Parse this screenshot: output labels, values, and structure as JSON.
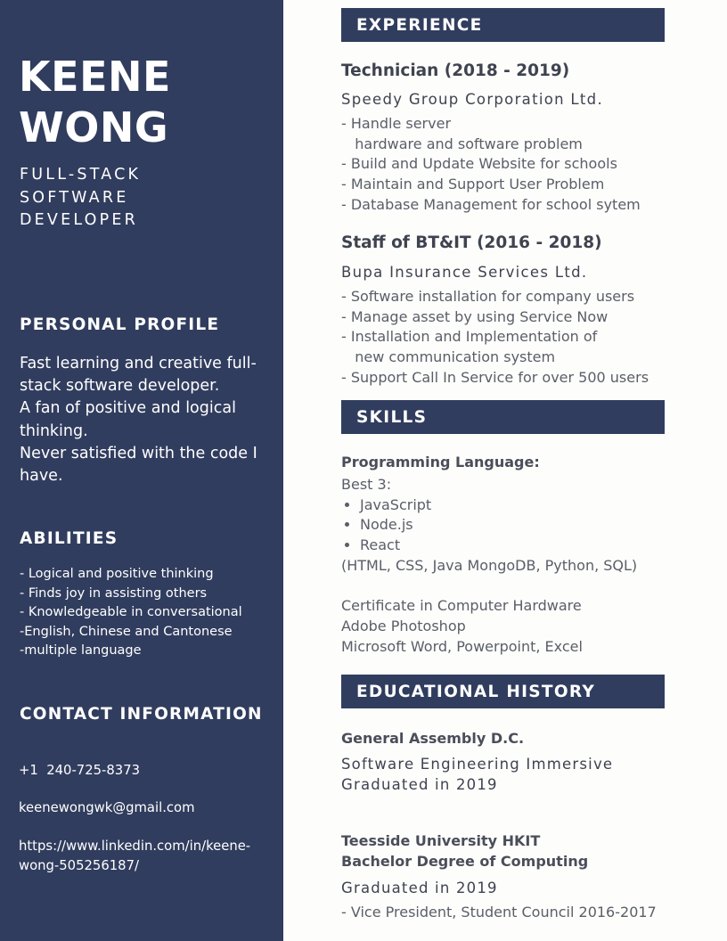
{
  "sidebar": {
    "name_line1": "KEENE",
    "name_line2": "WONG",
    "title_line1": "FULL-STACK",
    "title_line2": "SOFTWARE",
    "title_line3": "DEVELOPER",
    "profile_heading": "PERSONAL PROFILE",
    "profile_lines": [
      "Fast learning and creative full-",
      "stack software developer.",
      "A fan of positive and logical",
      "thinking.",
      "Never satisfied with the code I",
      "have."
    ],
    "abilities_heading": "ABILITIES",
    "abilities": [
      "- Logical and positive thinking",
      "- Finds joy in assisting others",
      "- Knowledgeable in conversational",
      "-English, Chinese and Cantonese",
      "-multiple language"
    ],
    "contact_heading": "CONTACT INFORMATION",
    "phone": "+1  240-725-8373",
    "email": "keenewongwk@gmail.com",
    "linkedin_line1": "https://www.linkedin.com/in/keene-",
    "linkedin_line2": "wong-505256187/"
  },
  "experience": {
    "heading": "EXPERIENCE",
    "jobs": [
      {
        "title": "Technician (2018 - 2019)",
        "company": "Speedy Group Corporation Ltd.",
        "bullets": [
          "- Handle server",
          "   hardware and software problem",
          "- Build and Update Website for schools",
          "- Maintain and Support User Problem",
          "- Database Management for school sytem"
        ]
      },
      {
        "title": "Staff of BT&IT (2016 - 2018)",
        "company": "Bupa Insurance Services Ltd.",
        "bullets": [
          "- Software installation for company users",
          "- Manage asset by using Service Now",
          "- Installation and Implementation of",
          "   new communication system",
          "- Support Call In Service for over 500 users"
        ]
      }
    ]
  },
  "skills": {
    "heading": "SKILLS",
    "programming_heading": "Programming Language:",
    "best_label": "Best 3:",
    "best": [
      "JavaScript",
      "Node.js",
      "React"
    ],
    "others": "(HTML, CSS, Java MongoDB, Python, SQL)",
    "extra": [
      "Certificate in Computer Hardware",
      "Adobe Photoshop",
      "Microsoft Word, Powerpoint, Excel"
    ]
  },
  "education": {
    "heading": "EDUCATIONAL HISTORY",
    "entries": [
      {
        "school": "General Assembly D.C.",
        "detail_line1": "Software Engineering Immersive",
        "detail_line2": "Graduated in 2019"
      },
      {
        "school": "Teesside University HKIT",
        "degree": "Bachelor Degree of Computing",
        "detail_line1": "Graduated in 2019",
        "note": "- Vice President, Student Council 2016-2017"
      }
    ]
  }
}
